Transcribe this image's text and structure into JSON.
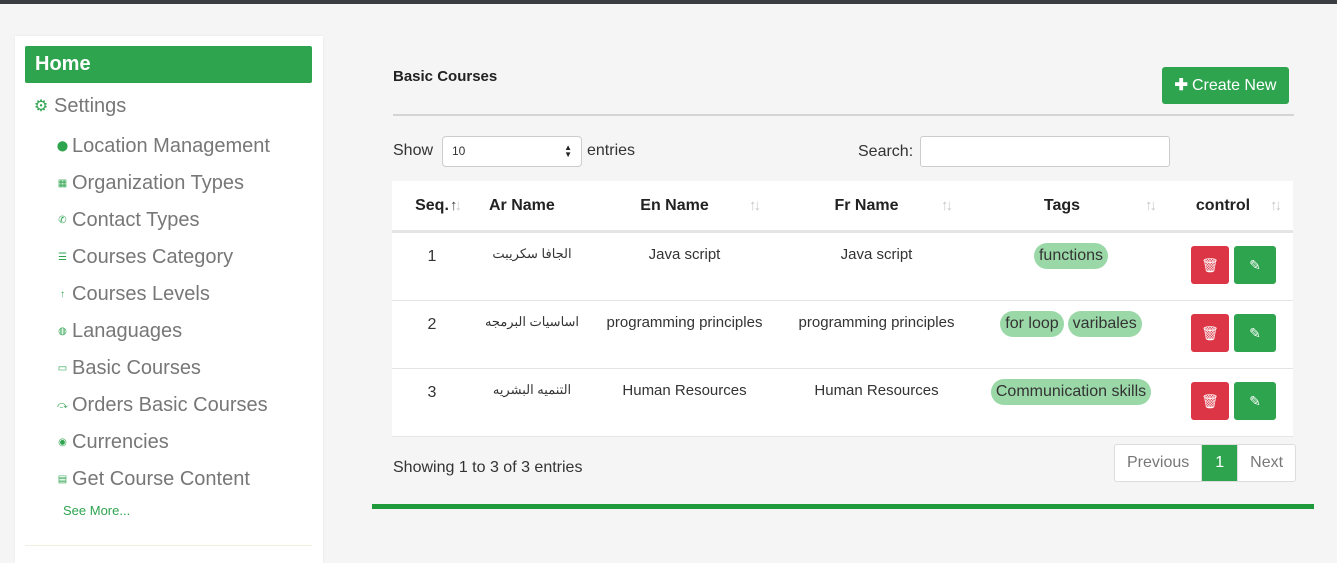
{
  "sidebar": {
    "home_label": "Home",
    "settings_label": "Settings",
    "items": [
      {
        "label": "Location Management",
        "icon": "map-marker-icon",
        "glyph": "⬤"
      },
      {
        "label": "Organization Types",
        "icon": "building-icon",
        "glyph": "▦"
      },
      {
        "label": "Contact Types",
        "icon": "phone-icon",
        "glyph": "✆"
      },
      {
        "label": "Courses Category",
        "icon": "list-icon",
        "glyph": "☰"
      },
      {
        "label": "Courses Levels",
        "icon": "level-up-icon",
        "glyph": "↑"
      },
      {
        "label": "Lanaguages",
        "icon": "globe-icon",
        "glyph": "◍"
      },
      {
        "label": "Basic Courses",
        "icon": "laptop-icon",
        "glyph": "▭"
      },
      {
        "label": "Orders Basic Courses",
        "icon": "hand-money-icon",
        "glyph": "⤼"
      },
      {
        "label": "Currencies",
        "icon": "coins-icon",
        "glyph": "◉"
      },
      {
        "label": "Get Course Content",
        "icon": "server-icon",
        "glyph": "▤"
      }
    ],
    "see_more": "See More..."
  },
  "main": {
    "title": "Basic Courses",
    "create_label": "Create New",
    "show_label": "Show",
    "page_size": "10",
    "entries_label": "entries",
    "search_label": "Search:",
    "search_value": ""
  },
  "table": {
    "headers": [
      "Seq.",
      "Ar Name",
      "En Name",
      "Fr Name",
      "Tags",
      "control"
    ],
    "rows": [
      {
        "seq": "1",
        "ar": "الجافا سكريبت",
        "en": "Java script",
        "fr": "Java script",
        "tags": [
          "functions"
        ]
      },
      {
        "seq": "2",
        "ar": "اساسيات البرمجه",
        "en": "programming principles",
        "fr": "programming principles",
        "tags": [
          "for loop",
          "varibales"
        ]
      },
      {
        "seq": "3",
        "ar": "التنميه البشريه",
        "en": "Human Resources",
        "fr": "Human Resources",
        "tags": [
          "Communication skills"
        ]
      }
    ]
  },
  "footer": {
    "info": "Showing 1 to 3 of 3 entries",
    "prev_label": "Previous",
    "current_page": "1",
    "next_label": "Next"
  },
  "colors": {
    "accent": "#2ea44f",
    "danger": "#dc3545",
    "tag": "#9bd8a8"
  }
}
